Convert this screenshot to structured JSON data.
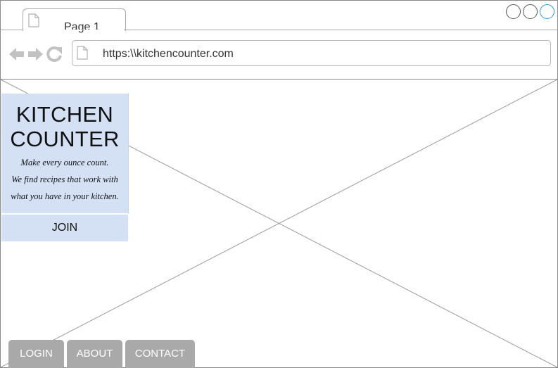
{
  "browser": {
    "tab_title": "Page 1",
    "url": "https:\\\\kitchencounter.com"
  },
  "icons": {
    "tab_page": "page-icon",
    "back": "back-arrow-icon",
    "forward": "forward-arrow-icon",
    "reload": "reload-icon",
    "address_page": "page-icon",
    "window_controls": [
      "circle",
      "circle",
      "circle"
    ]
  },
  "colors": {
    "card_bg": "#d4e1f4",
    "nav_button_bg": "#a9a9a9",
    "active_window_control": "#2a9be0"
  },
  "brand": {
    "title_line1": "KITCHEN",
    "title_line2": "COUNTER",
    "tagline_line1": "Make every ounce count.",
    "tagline_line2": "We find recipes that work with",
    "tagline_line3": "what you have in your kitchen."
  },
  "cta": {
    "join_label": "JOIN"
  },
  "bottom_nav": {
    "login": "LOGIN",
    "about": "ABOUT",
    "contact": "CONTACT"
  }
}
